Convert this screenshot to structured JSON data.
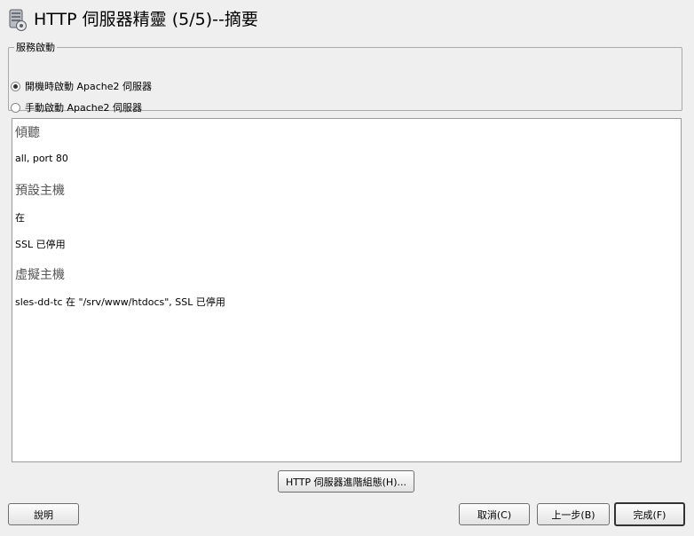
{
  "header": {
    "title": "HTTP 伺服器精靈 (5/5)--摘要",
    "icon": "server-wizard-icon"
  },
  "startup": {
    "legend": "服務啟動",
    "options": [
      {
        "label": "開機時啟動 Apache2 伺服器",
        "checked": true
      },
      {
        "label": "手動啟動 Apache2 伺服器",
        "checked": false
      }
    ]
  },
  "summary": {
    "listen_heading": "傾聽",
    "listen_value": "all, port 80",
    "default_host_heading": "預設主機",
    "default_host_enabled": "在",
    "default_host_ssl": "SSL 已停用",
    "vhosts_heading": "虛擬主機",
    "vhost_entry": "sles-dd-tc 在 \"/srv/www/htdocs\", SSL 已停用"
  },
  "buttons": {
    "advanced": "HTTP 伺服器進階組態(H)...",
    "help": "說明",
    "cancel": "取消(C)",
    "back": "上一步(B)",
    "finish": "完成(F)"
  }
}
